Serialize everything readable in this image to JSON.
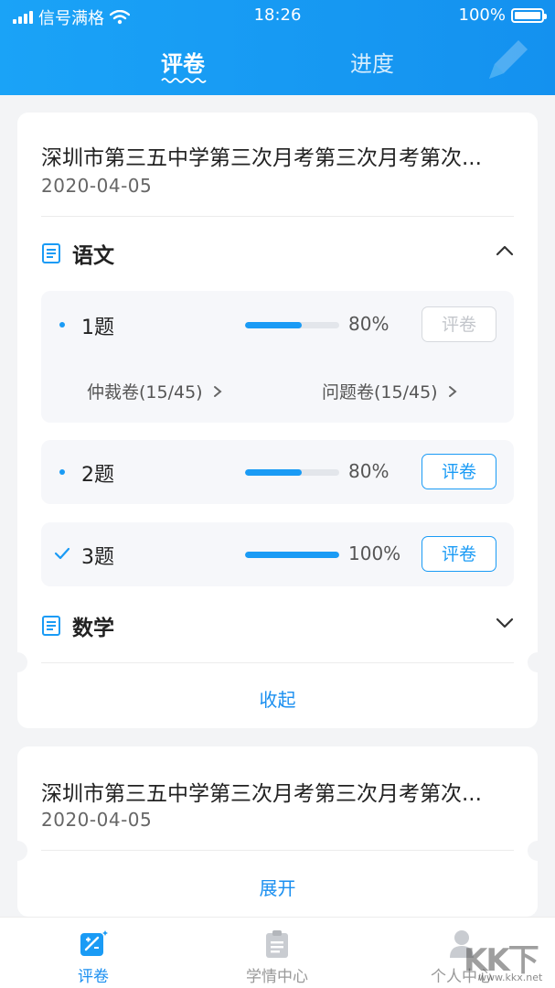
{
  "status_bar": {
    "carrier": "信号满格",
    "time": "18:26",
    "battery": "100%"
  },
  "header": {
    "tabs": [
      {
        "label": "评卷",
        "active": true
      },
      {
        "label": "进度",
        "active": false
      }
    ]
  },
  "exam_cards": [
    {
      "title": "深圳市第三五中学第三次月考第三次月考第次...",
      "date": "2020-04-05",
      "subjects": [
        {
          "name": "语文",
          "expanded": true,
          "questions": [
            {
              "name": "1题",
              "progress": 0.6,
              "percent": "80%",
              "action": "评卷",
              "enabled": false,
              "completed": false,
              "links": [
                {
                  "label": "仲裁卷(15/45)"
                },
                {
                  "label": "问题卷(15/45)"
                }
              ]
            },
            {
              "name": "2题",
              "progress": 0.6,
              "percent": "80%",
              "action": "评卷",
              "enabled": true,
              "completed": false
            },
            {
              "name": "3题",
              "progress": 1.0,
              "percent": "100%",
              "action": "评卷",
              "enabled": true,
              "completed": true
            }
          ]
        },
        {
          "name": "数学",
          "expanded": false
        }
      ],
      "toggle_label": "收起"
    },
    {
      "title": "深圳市第三五中学第三次月考第三次月考第次...",
      "date": "2020-04-05",
      "toggle_label": "展开"
    }
  ],
  "bottom_nav": [
    {
      "label": "评卷",
      "icon": "grading-icon",
      "active": true
    },
    {
      "label": "学情中心",
      "icon": "clipboard-icon",
      "active": false
    },
    {
      "label": "个人中心",
      "icon": "person-icon",
      "active": false
    }
  ],
  "watermark": {
    "big": "KK下载",
    "small": "www.kkx.net"
  },
  "colors": {
    "primary": "#1a9bf5",
    "header_start": "#1aa3f7",
    "header_end": "#1491ef"
  }
}
